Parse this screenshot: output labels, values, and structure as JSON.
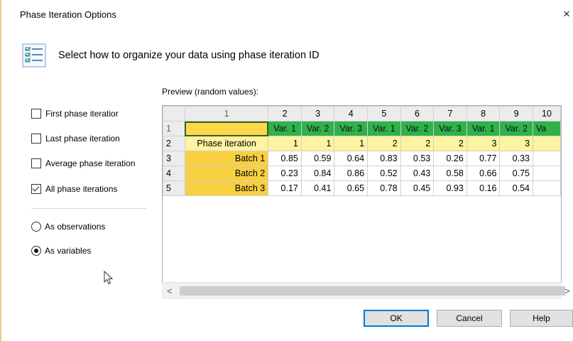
{
  "window": {
    "title": "Phase Iteration Options",
    "close_glyph": "×"
  },
  "header": {
    "icon": "checklist-icon",
    "text": "Select how to organize your data using phase iteration ID"
  },
  "preview_label": "Preview (random values):",
  "options": {
    "checkboxes": [
      {
        "label": "First phase iteratior",
        "checked": false
      },
      {
        "label": "Last phase iteration",
        "checked": false
      },
      {
        "label": "Average phase iteration",
        "checked": false
      },
      {
        "label": "All phase iterations",
        "checked": true
      }
    ],
    "radios": [
      {
        "label": "As observations",
        "selected": false
      },
      {
        "label": "As variables",
        "selected": true
      }
    ]
  },
  "grid": {
    "column_headers": [
      "1",
      "2",
      "3",
      "4",
      "5",
      "6",
      "7",
      "8",
      "9",
      "10"
    ],
    "rows": [
      {
        "num": "1",
        "cells": [
          "",
          "Var. 1",
          "Var. 2",
          "Var. 3",
          "Var. 1",
          "Var. 2",
          "Var. 3",
          "Var. 1",
          "Var. 2",
          "Va"
        ]
      },
      {
        "num": "2",
        "cells": [
          "Phase iteration",
          "1",
          "1",
          "1",
          "2",
          "2",
          "2",
          "3",
          "3",
          ""
        ]
      },
      {
        "num": "3",
        "cells": [
          "Batch 1",
          "0.85",
          "0.59",
          "0.64",
          "0.83",
          "0.53",
          "0.26",
          "0.77",
          "0.33",
          ""
        ]
      },
      {
        "num": "4",
        "cells": [
          "Batch 2",
          "0.23",
          "0.84",
          "0.86",
          "0.52",
          "0.43",
          "0.58",
          "0.66",
          "0.75",
          ""
        ]
      },
      {
        "num": "5",
        "cells": [
          "Batch 3",
          "0.17",
          "0.41",
          "0.65",
          "0.78",
          "0.45",
          "0.93",
          "0.16",
          "0.54",
          ""
        ]
      }
    ]
  },
  "scrollbar": {
    "left_arrow": "<",
    "right_arrow": ">"
  },
  "buttons": {
    "ok": "OK",
    "cancel": "Cancel",
    "help": "Help"
  },
  "colors": {
    "var_row": "#2fb24a",
    "phase_row": "#fdf3a0",
    "label_column": "#f7cf40",
    "default_button_border": "#0078d7"
  }
}
